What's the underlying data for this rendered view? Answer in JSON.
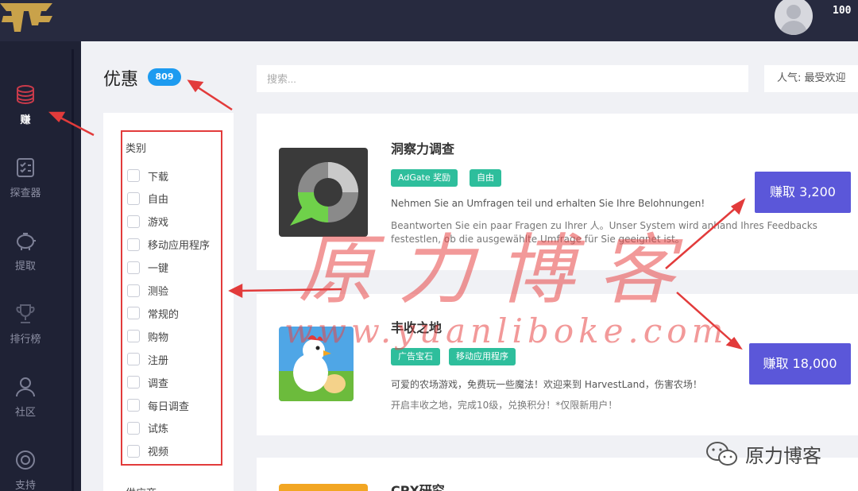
{
  "header": {
    "balance": "100"
  },
  "nav": [
    {
      "label": "赚",
      "icon": "coins-icon",
      "active": true
    },
    {
      "label": "探查器",
      "icon": "checklist-icon"
    },
    {
      "label": "提取",
      "icon": "piggy-bank-icon"
    },
    {
      "label": "排行榜",
      "icon": "trophy-icon"
    },
    {
      "label": "社区",
      "icon": "people-icon"
    },
    {
      "label": "支持",
      "icon": "lifebuoy-icon"
    }
  ],
  "page": {
    "title": "优惠",
    "count": "809"
  },
  "search": {
    "placeholder": "搜索..."
  },
  "sort": {
    "label": "人气: 最受欢迎"
  },
  "filters": {
    "category_title": "类别",
    "items": [
      "下载",
      "自由",
      "游戏",
      "移动应用程序",
      "一键",
      "测验",
      "常规的",
      "购物",
      "注册",
      "调查",
      "每日调查",
      "试炼",
      "视频"
    ],
    "provider_title": "供应商"
  },
  "offers": [
    {
      "title": "洞察力调查",
      "tags": [
        "AdGate 奖励",
        "自由"
      ],
      "desc": "Nehmen Sie an Umfragen teil und erhalten Sie Ihre Belohnungen!",
      "sub1": "Beantworten Sie ein paar Fragen zu Ihrer 人。Unser System wird anhand Ihres Feedbacks",
      "sub2": "festestlen, ob die ausgewählte Umfrage für Sie geeignet ist。",
      "button": "赚取 3,200"
    },
    {
      "title": "丰收之地",
      "tags": [
        "广告宝石",
        "移动应用程序"
      ],
      "desc": "可爱的农场游戏，免费玩一些魔法！欢迎来到 HarvestLand，伤害农场！",
      "sub1": "开启丰收之地，完成10级，兑换积分！*仅限新用户！",
      "button": "赚取 18,000"
    },
    {
      "title": "CPX研究"
    }
  ],
  "watermark": {
    "main": "原力博客",
    "url": "www.yuanliboke.com",
    "wechat": "原力博客"
  },
  "colors": {
    "topbar": "#272a3f",
    "nav": "#1f2235",
    "badge": "#1d9bf0",
    "tag": "#2ebe9c",
    "button": "#5b57d9",
    "annotation": "#e23b3b"
  }
}
